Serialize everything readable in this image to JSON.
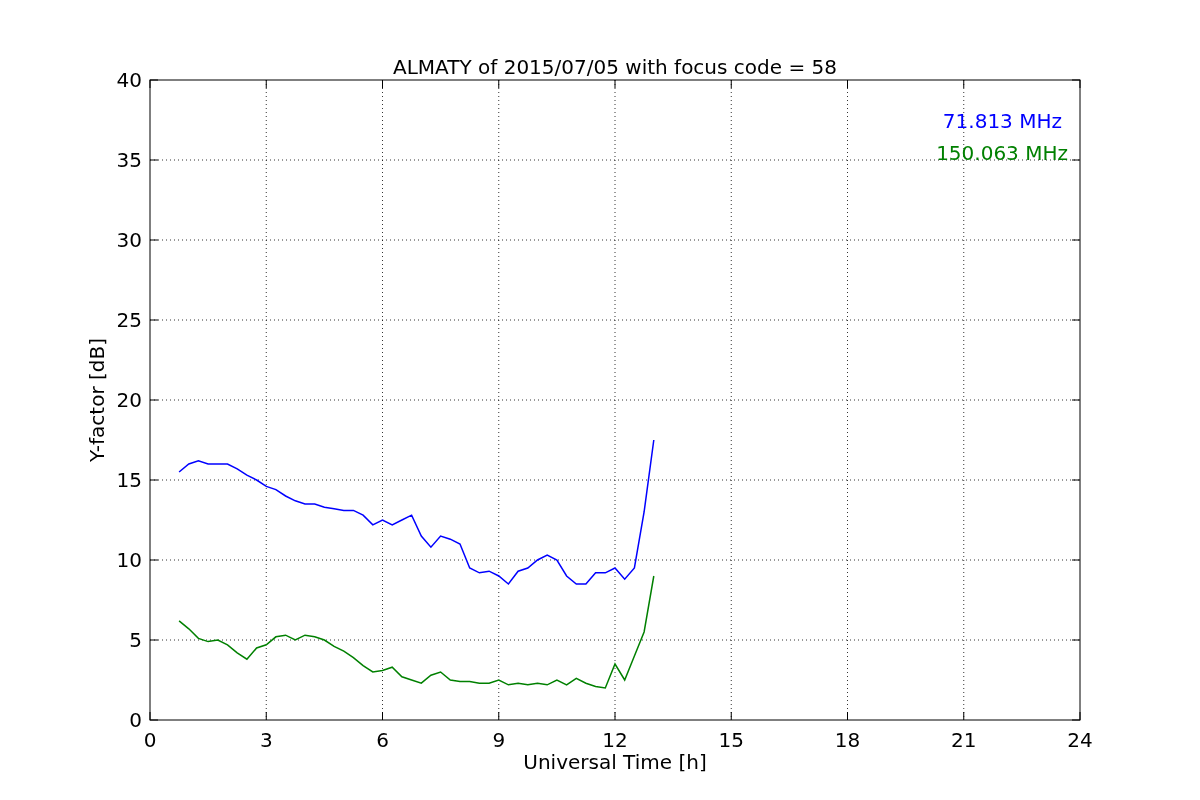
{
  "plot": {
    "chart_data": {
      "type": "line",
      "title": "ALMATY of 2015/07/05 with focus code = 58",
      "xlabel": "Universal Time [h]",
      "ylabel": "Y-factor [dB]",
      "x": [
        0.75,
        1.0,
        1.25,
        1.5,
        1.75,
        2.0,
        2.25,
        2.5,
        2.75,
        3.0,
        3.25,
        3.5,
        3.75,
        4.0,
        4.25,
        4.5,
        4.75,
        5.0,
        5.25,
        5.5,
        5.75,
        6.0,
        6.25,
        6.5,
        6.75,
        7.0,
        7.25,
        7.5,
        7.75,
        8.0,
        8.25,
        8.5,
        8.75,
        9.0,
        9.25,
        9.5,
        9.75,
        10.0,
        10.25,
        10.5,
        10.75,
        11.0,
        11.25,
        11.5,
        11.75,
        12.0,
        12.25,
        12.5,
        12.75,
        13.0
      ],
      "series": [
        {
          "name": "71.813 MHz",
          "color": "#0000ff",
          "values": [
            15.5,
            16.0,
            16.2,
            16.0,
            16.0,
            16.0,
            15.7,
            15.3,
            15.0,
            14.6,
            14.4,
            14.0,
            13.7,
            13.5,
            13.5,
            13.3,
            13.2,
            13.1,
            13.1,
            12.8,
            12.2,
            12.5,
            12.2,
            12.5,
            12.8,
            11.5,
            10.8,
            11.5,
            11.3,
            11.0,
            9.5,
            9.2,
            9.3,
            9.0,
            8.5,
            9.3,
            9.5,
            10.0,
            10.3,
            10.0,
            9.0,
            8.5,
            8.5,
            9.2,
            9.2,
            9.5,
            8.8,
            9.5,
            13.0,
            17.5
          ]
        },
        {
          "name": "150.063 MHz",
          "color": "#008000",
          "values": [
            6.2,
            5.7,
            5.1,
            4.9,
            5.0,
            4.7,
            4.2,
            3.8,
            4.5,
            4.7,
            5.2,
            5.3,
            5.0,
            5.3,
            5.2,
            5.0,
            4.6,
            4.3,
            3.9,
            3.4,
            3.0,
            3.1,
            3.3,
            2.7,
            2.5,
            2.3,
            2.8,
            3.0,
            2.5,
            2.4,
            2.4,
            2.3,
            2.3,
            2.5,
            2.2,
            2.3,
            2.2,
            2.3,
            2.2,
            2.5,
            2.2,
            2.6,
            2.3,
            2.1,
            2.0,
            3.5,
            2.5,
            4.0,
            5.5,
            9.0
          ]
        }
      ],
      "grid": true,
      "xlim": [
        0,
        24
      ],
      "ylim": [
        0,
        40
      ],
      "xticks": [
        0,
        3,
        6,
        9,
        12,
        15,
        18,
        21,
        24
      ],
      "yticks": [
        0,
        5,
        10,
        15,
        20,
        25,
        30,
        35,
        40
      ]
    }
  }
}
